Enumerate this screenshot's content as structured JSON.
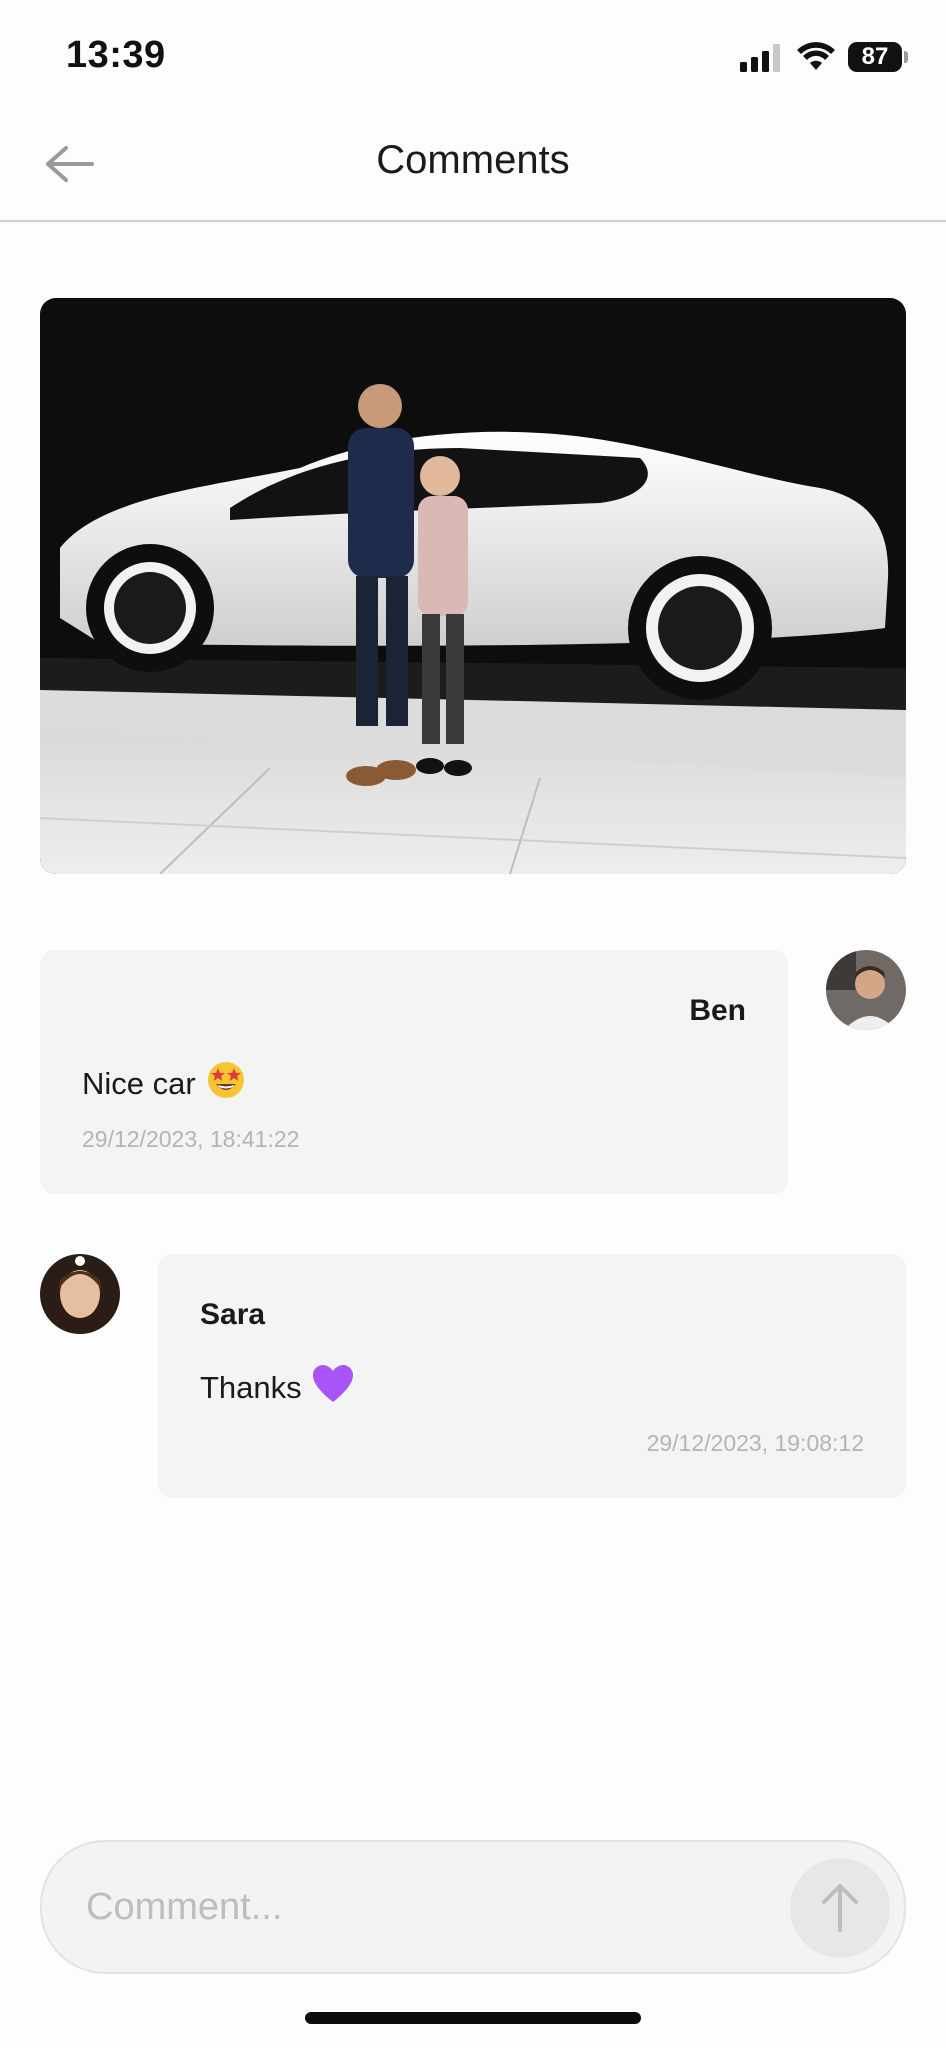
{
  "status_bar": {
    "time": "13:39",
    "battery": "87",
    "signal_icon": "cellular-signal-icon",
    "wifi_icon": "wifi-icon"
  },
  "header": {
    "title": "Comments",
    "back_icon": "arrow-left-icon"
  },
  "post_image": {
    "description_icon": "photo"
  },
  "comments": [
    {
      "author": "Ben",
      "text": "Nice car",
      "emoji": "🤩",
      "timestamp": "29/12/2023, 18:41:22",
      "align": "right"
    },
    {
      "author": "Sara",
      "text": "Thanks",
      "emoji": "💜",
      "timestamp": "29/12/2023, 19:08:12",
      "align": "left"
    }
  ],
  "composer": {
    "placeholder": "Comment...",
    "send_icon": "arrow-up-icon"
  },
  "colors": {
    "bubble": "#f4f4f4",
    "timestamp": "#b4b4b4",
    "purple_heart": "#a855f7"
  }
}
